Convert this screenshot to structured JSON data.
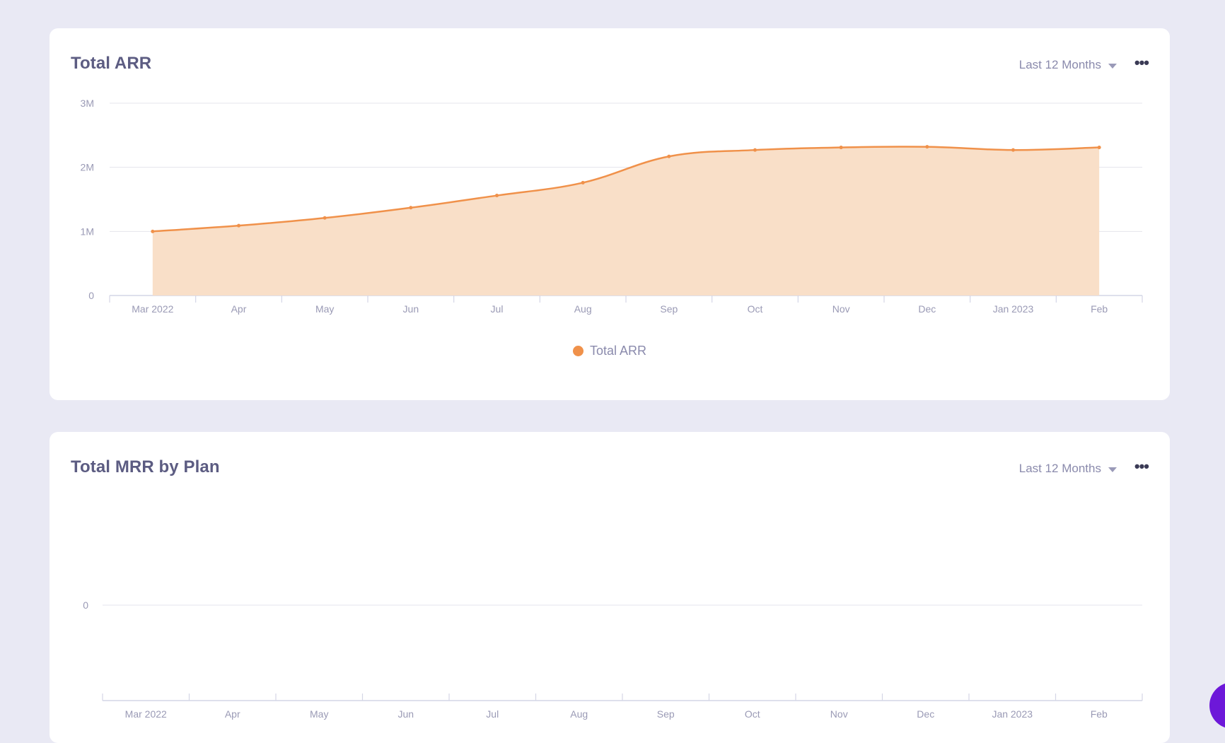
{
  "colors": {
    "page_bg": "#e9e9f4",
    "card_bg": "#ffffff",
    "series_line": "#f0914a",
    "series_fill": "#f9dfc8",
    "grid": "#e4e4ec",
    "tick_text": "#9a9ab5",
    "title_text": "#5c5c82",
    "fab": "#6d18d9"
  },
  "arr_card": {
    "title": "Total ARR",
    "period_label": "Last 12 Months",
    "period_icon": "caret-down-icon",
    "more_icon": "ellipsis-icon",
    "more_label": "•••"
  },
  "mrr_card": {
    "title": "Total MRR by Plan",
    "period_label": "Last 12 Months",
    "period_icon": "caret-down-icon",
    "more_icon": "ellipsis-icon",
    "more_label": "•••"
  },
  "chart_data": [
    {
      "type": "area",
      "title": "Total ARR",
      "categories": [
        "Mar 2022",
        "Apr",
        "May",
        "Jun",
        "Jul",
        "Aug",
        "Sep",
        "Oct",
        "Nov",
        "Dec",
        "Jan 2023",
        "Feb"
      ],
      "series": [
        {
          "name": "Total ARR",
          "color": "#f0914a",
          "values": [
            1000000,
            1090000,
            1210000,
            1370000,
            1560000,
            1760000,
            2170000,
            2270000,
            2310000,
            2320000,
            2270000,
            2310000
          ]
        }
      ],
      "yticks": [
        "0",
        "1M",
        "2M",
        "3M"
      ],
      "ylim": [
        0,
        3000000
      ],
      "grid": true,
      "legend": "bottom-center"
    },
    {
      "type": "bar",
      "title": "Total MRR by Plan",
      "categories": [
        "Mar 2022",
        "Apr",
        "May",
        "Jun",
        "Jul",
        "Aug",
        "Sep",
        "Oct",
        "Nov",
        "Dec",
        "Jan 2023",
        "Feb"
      ],
      "series": [],
      "yticks": [
        "0"
      ],
      "grid": true
    }
  ]
}
